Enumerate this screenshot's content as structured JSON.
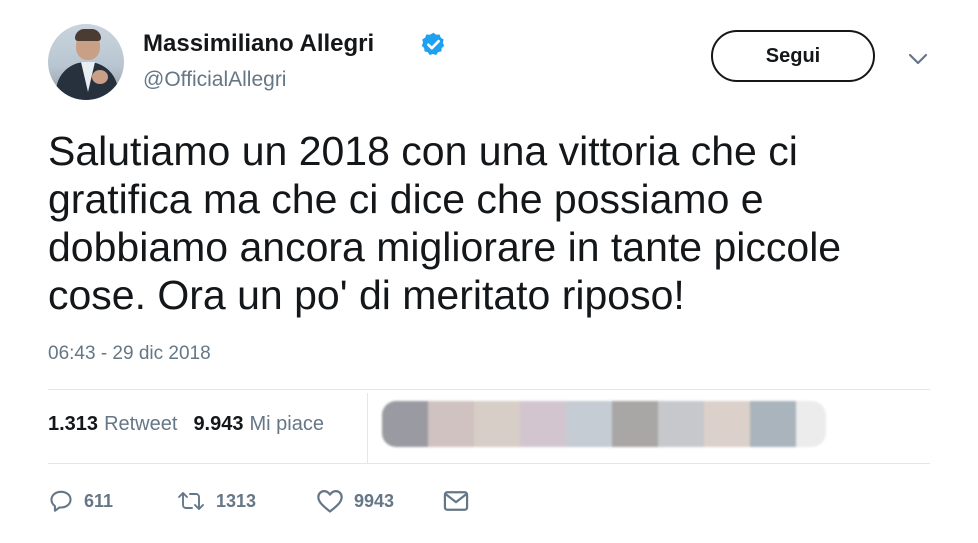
{
  "author": {
    "display_name": "Massimiliano Allegri",
    "handle": "@OfficialAllegri",
    "verified": true
  },
  "follow_button": {
    "label": "Segui"
  },
  "tweet": {
    "text_lines": [
      "Salutiamo un 2018 con una vittoria che ci",
      "gratifica ma che ci dice che possiamo e",
      "dobbiamo ancora migliorare in tante piccole",
      "cose. Ora un po' di meritato riposo!"
    ],
    "timestamp": "06:43 - 29 dic 2018"
  },
  "stats": {
    "retweets_count": "1.313",
    "retweets_label": "Retweet",
    "likes_count": "9.943",
    "likes_label": "Mi piace"
  },
  "liker_avatars": [
    "#9a9aa2",
    "#cfc2c0",
    "#d8cec8",
    "#d2c5cf",
    "#c5ccd3",
    "#a9a6a6",
    "#c7c8cc",
    "#dcd0ca",
    "#a9b4bd",
    "#ececec"
  ],
  "actions": {
    "reply_count": "611",
    "retweet_count": "1313",
    "like_count": "9943"
  },
  "colors": {
    "verified_blue": "#1da1f2",
    "secondary_text": "#657786",
    "primary_text": "#14171a",
    "divider": "#e1e8ed"
  },
  "icons": {
    "verified": "verified-badge-icon",
    "chevron": "chevron-down-icon",
    "reply": "reply-icon",
    "retweet": "retweet-icon",
    "like": "heart-icon",
    "dm": "envelope-icon"
  }
}
